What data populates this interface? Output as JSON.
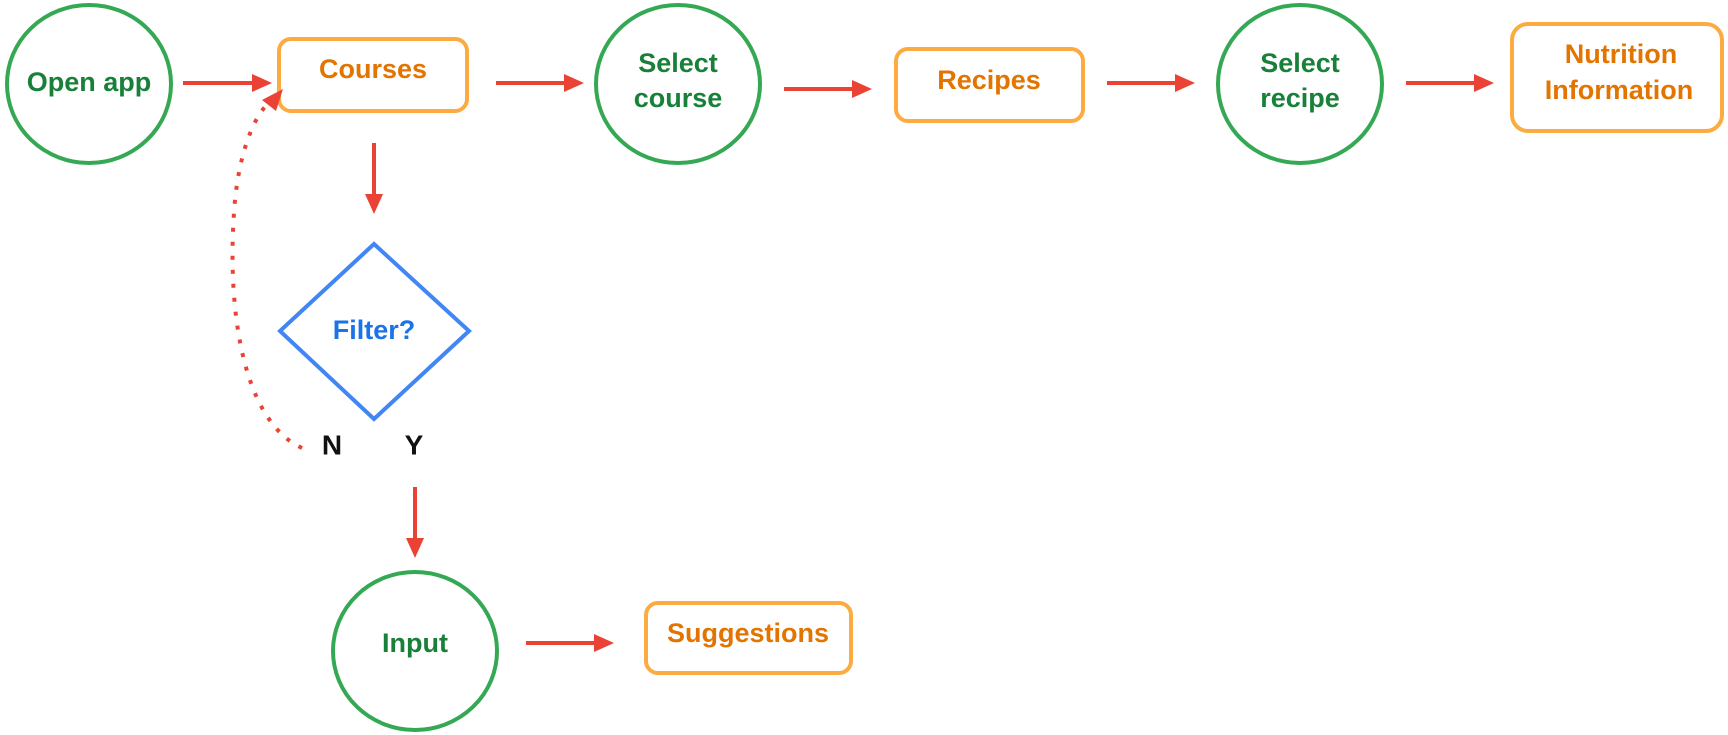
{
  "diagram": {
    "type": "flowchart",
    "colors": {
      "action_stroke": "#34A853",
      "action_text": "#188038",
      "screen_stroke": "#FBAB40",
      "screen_text": "#E37400",
      "decision_stroke": "#4285F4",
      "decision_text": "#1A73E8",
      "edge": "#EA4335"
    },
    "nodes": {
      "open_app": {
        "shape": "circle",
        "lines": [
          "Open app"
        ]
      },
      "courses": {
        "shape": "rounded-rect",
        "lines": [
          "Courses"
        ]
      },
      "select_course": {
        "shape": "circle",
        "lines": [
          "Select",
          "course"
        ]
      },
      "recipes": {
        "shape": "rounded-rect",
        "lines": [
          "Recipes"
        ]
      },
      "select_recipe": {
        "shape": "circle",
        "lines": [
          "Select",
          "recipe"
        ]
      },
      "nutrition": {
        "shape": "rounded-rect",
        "lines": [
          "Nutrition",
          "Information"
        ]
      },
      "filter": {
        "shape": "diamond",
        "lines": [
          "Filter?"
        ]
      },
      "input": {
        "shape": "circle",
        "lines": [
          "Input"
        ]
      },
      "suggestions": {
        "shape": "rounded-rect",
        "lines": [
          "Suggestions"
        ]
      }
    },
    "branch_labels": {
      "no": "N",
      "yes": "Y"
    },
    "edges": [
      {
        "from": "open_app",
        "to": "courses",
        "style": "solid"
      },
      {
        "from": "courses",
        "to": "select_course",
        "style": "solid"
      },
      {
        "from": "select_course",
        "to": "recipes",
        "style": "solid"
      },
      {
        "from": "recipes",
        "to": "select_recipe",
        "style": "solid"
      },
      {
        "from": "select_recipe",
        "to": "nutrition",
        "style": "solid"
      },
      {
        "from": "courses",
        "to": "filter",
        "style": "solid"
      },
      {
        "from": "filter",
        "to": "courses",
        "label": "N",
        "style": "dotted"
      },
      {
        "from": "filter",
        "to": "input",
        "label": "Y",
        "style": "solid"
      },
      {
        "from": "input",
        "to": "suggestions",
        "style": "solid"
      }
    ]
  }
}
